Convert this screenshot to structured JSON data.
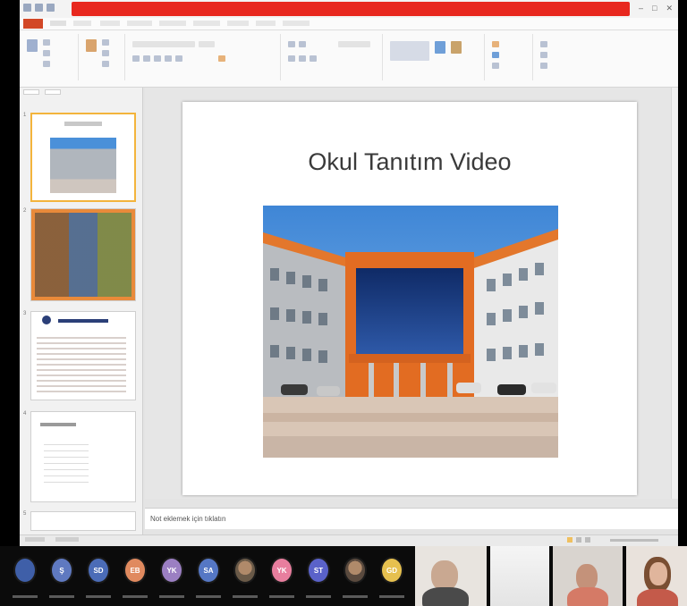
{
  "slide": {
    "title": "Okul Tanıtım Video"
  },
  "notes": {
    "placeholder": "Not eklemek için tıklatın"
  },
  "colors": {
    "title_bar": "#e8281f",
    "file_tab": "#d24726",
    "selected_thumb": "#f3b43c",
    "slide_bg": "#ffffff",
    "workspace_bg": "#e4e4e4"
  },
  "participants": [
    {
      "initials": "",
      "color": "#3f5fa8",
      "icon": "user-icon"
    },
    {
      "initials": "Ş",
      "color": "#5f79c0"
    },
    {
      "initials": "SD",
      "color": "#4b6cb7"
    },
    {
      "initials": "EB",
      "color": "#e08a5f"
    },
    {
      "initials": "YK",
      "color": "#9b7fc2"
    },
    {
      "initials": "SA",
      "color": "#5577c4"
    },
    {
      "initials": "",
      "color": "#6a5a48",
      "icon": "photo-avatar"
    },
    {
      "initials": "YK",
      "color": "#e87e9e"
    },
    {
      "initials": "ST",
      "color": "#5a62c9"
    },
    {
      "initials": "",
      "color": "#5a4a3e",
      "icon": "photo-avatar"
    },
    {
      "initials": "GD",
      "color": "#e6c04f"
    }
  ]
}
